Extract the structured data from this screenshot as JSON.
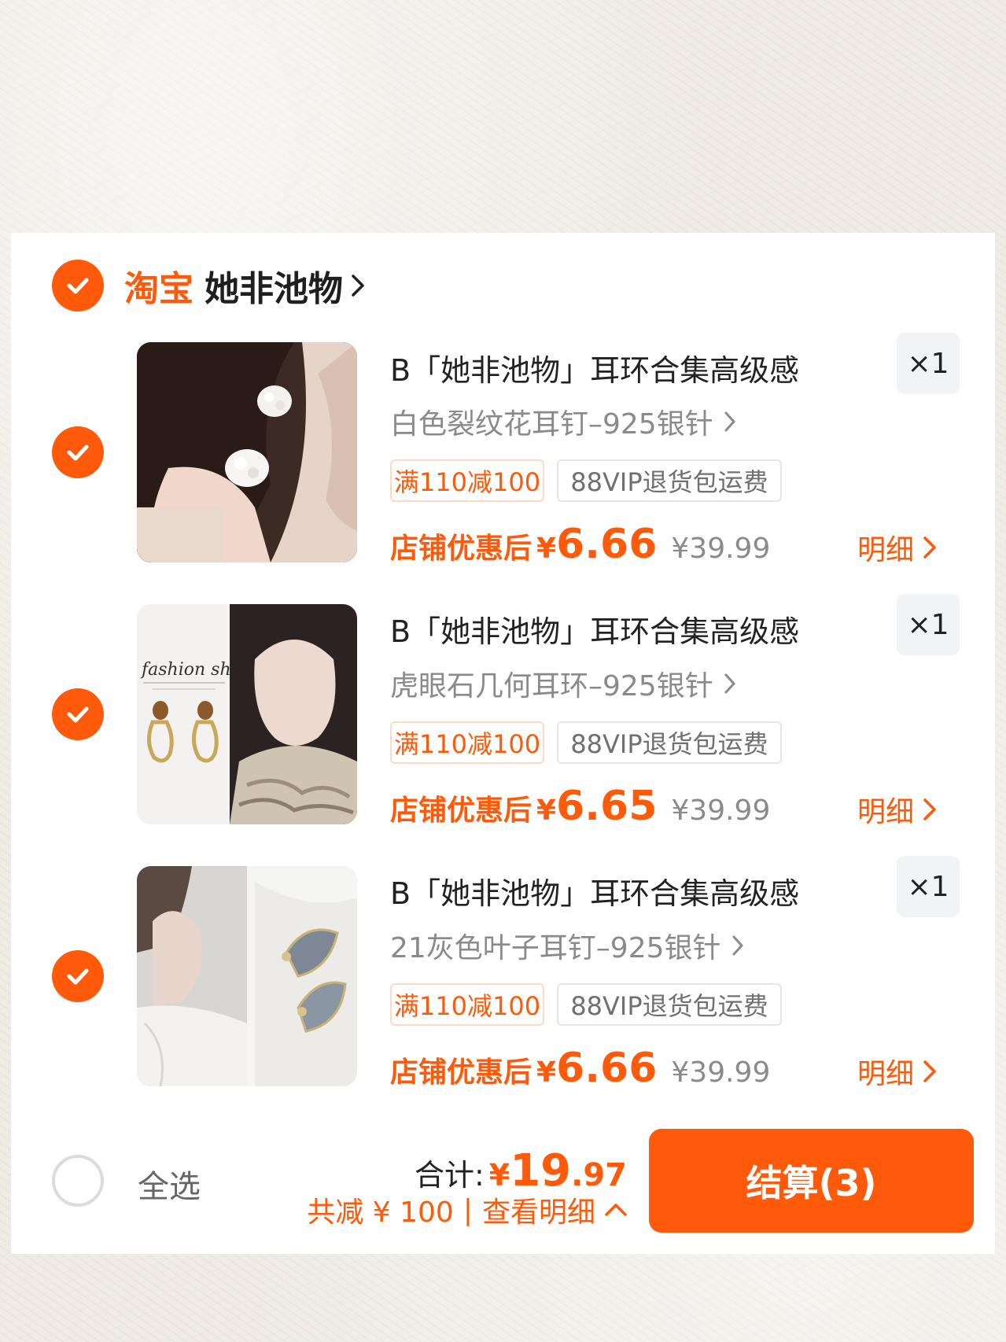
{
  "colors": {
    "accent": "#ff5a0a",
    "card_bg": "#ffffff",
    "qty_bg": "#f2f3f5"
  },
  "shop": {
    "brand": "淘宝",
    "name": "她非池物",
    "chevron_icon": "chevron-right-icon"
  },
  "items": [
    {
      "title": "B「她非池物」耳环合集高级感",
      "sku": "白色裂纹花耳钉–925银针",
      "quantity": "×1",
      "tags": [
        "满110减100",
        "88VIP退货包运费"
      ],
      "price_label": "店铺优惠后",
      "price_currency": "¥",
      "price": "6.66",
      "original_price": "¥39.99",
      "detail": "明细",
      "image": "white-crackle-flower-stud-earring-photo"
    },
    {
      "title": "B「她非池物」耳环合集高级感",
      "sku": "虎眼石几何耳环–925银针",
      "quantity": "×1",
      "tags": [
        "满110减100",
        "88VIP退货包运费"
      ],
      "price_label": "店铺优惠后",
      "price_currency": "¥",
      "price": "6.65",
      "original_price": "¥39.99",
      "detail": "明细",
      "image": "tiger-eye-geometric-earring-photo",
      "image_text": "fashion show"
    },
    {
      "title": "B「她非池物」耳环合集高级感",
      "sku": "21灰色叶子耳钉–925银针",
      "quantity": "×1",
      "tags": [
        "满110减100",
        "88VIP退货包运费"
      ],
      "price_label": "店铺优惠后",
      "price_currency": "¥",
      "price": "6.66",
      "original_price": "¥39.99",
      "detail": "明细",
      "image": "grey-leaf-stud-earring-photo"
    }
  ],
  "footer": {
    "select_all": "全选",
    "total_label": "合计:",
    "total_currency": "¥",
    "total_int": "19",
    "total_dec": ".97",
    "savings": "共减 ¥ 100",
    "separator": "|",
    "view_details": "查看明细",
    "checkout": "结算(3)"
  }
}
